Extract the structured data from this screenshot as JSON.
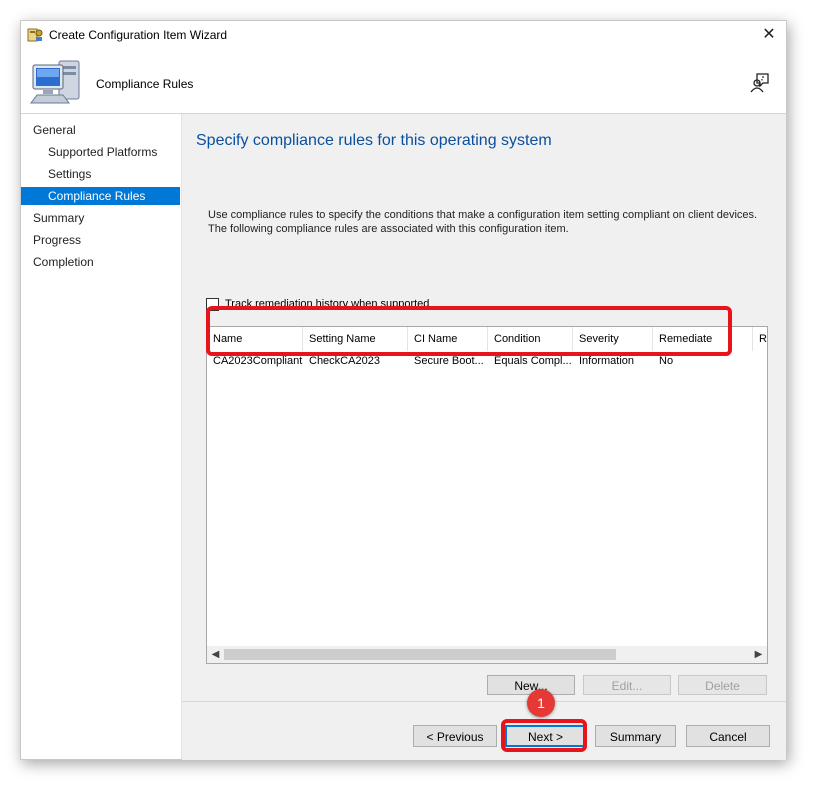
{
  "window": {
    "title": "Create Configuration Item Wizard",
    "close_glyph": "✕",
    "header_title": "Compliance Rules"
  },
  "nav": {
    "items": [
      {
        "label": "General",
        "level": 0,
        "selected": false
      },
      {
        "label": "Supported Platforms",
        "level": 1,
        "selected": false
      },
      {
        "label": "Settings",
        "level": 1,
        "selected": false
      },
      {
        "label": "Compliance Rules",
        "level": 1,
        "selected": true
      },
      {
        "label": "Summary",
        "level": 0,
        "selected": false
      },
      {
        "label": "Progress",
        "level": 0,
        "selected": false
      },
      {
        "label": "Completion",
        "level": 0,
        "selected": false
      }
    ]
  },
  "content": {
    "heading": "Specify compliance rules for this operating system",
    "description": "Use compliance rules to specify the conditions that make a configuration item setting compliant on client devices. The following compliance rules are associated with this configuration item.",
    "track_label": "Track remediation history when supported",
    "track_checked": false
  },
  "table": {
    "columns": [
      "Name",
      "Setting Name",
      "CI Name",
      "Condition",
      "Severity",
      "Remediate",
      "R"
    ],
    "rows": [
      [
        "CA2023Compliant",
        "CheckCA2023",
        "Secure Boot...",
        "Equals Compl...",
        "Information",
        "No",
        ""
      ]
    ]
  },
  "rule_buttons": {
    "new": "New...",
    "edit": "Edit...",
    "delete": "Delete"
  },
  "footer": {
    "previous": "< Previous",
    "next": "Next >",
    "summary": "Summary",
    "cancel": "Cancel"
  },
  "annotation": {
    "badge": "1",
    "color": "#e8141c"
  },
  "colors": {
    "accent": "#0078d7",
    "heading": "#0a4fa0"
  }
}
